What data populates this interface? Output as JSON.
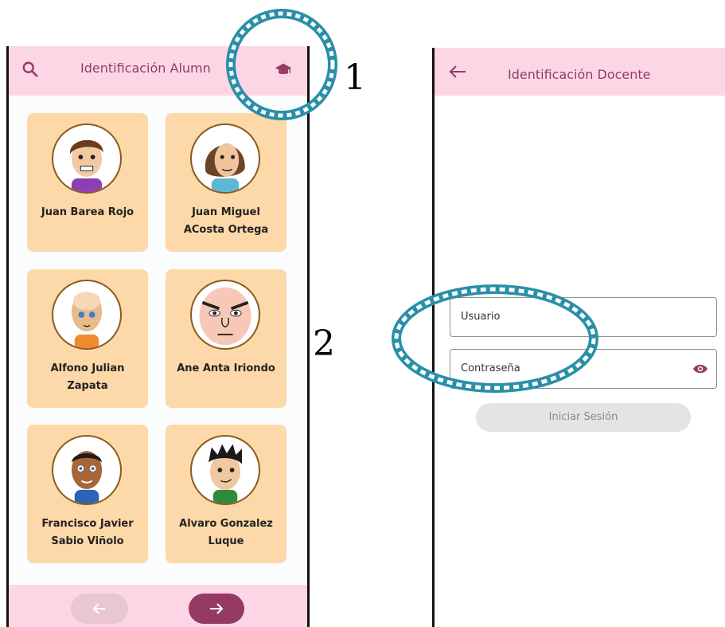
{
  "student_screen": {
    "title": "Identificación Alumn",
    "students": [
      {
        "name": "Juan Barea Rojo"
      },
      {
        "name": "Juan Miguel ACosta Ortega"
      },
      {
        "name": "Alfono Julian Zapata"
      },
      {
        "name": "Ane Anta Iriondo"
      },
      {
        "name": "Francisco Javier Sabio Viñolo"
      },
      {
        "name": "Alvaro Gonzalez Luque"
      }
    ],
    "nav": {
      "prev_icon": "arrow-left-icon",
      "next_icon": "arrow-right-icon"
    }
  },
  "teacher_screen": {
    "title": "Identificación Docente",
    "username_placeholder": "Usuario",
    "password_placeholder": "Contraseña",
    "login_label": "Iniciar Sesión"
  },
  "annotations": {
    "label_1": "1",
    "label_2": "2"
  },
  "colors": {
    "bar_pink": "#fcd6e5",
    "brand_plum": "#953b63",
    "card_peach": "#fdd8a8",
    "ring_teal": "#2a8fa8"
  }
}
